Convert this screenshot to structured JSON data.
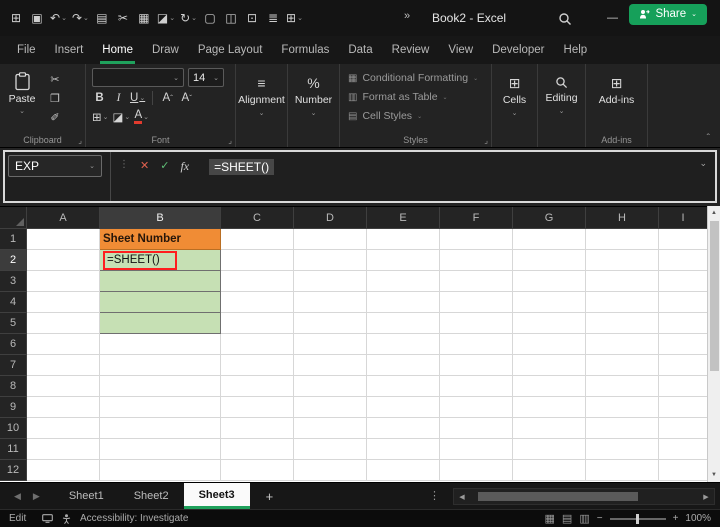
{
  "theme": {
    "accent_green": "#1FA15C",
    "share_green": "#16A05A"
  },
  "icons": {
    "chevron_down": "⌄",
    "dialog_launcher": "⌟",
    "collapse_ribbon": "ˆ",
    "scroll_up": "▲",
    "scroll_down": "▼",
    "arrow_left": "◀",
    "arrow_right": "▶",
    "dots_vertical": "⋮",
    "plus": "+"
  },
  "titlebar": {
    "title": "Book2 - Excel",
    "overflow_glyph": "»",
    "window": {
      "minimize": "—",
      "maximize": "□",
      "close": "✕"
    },
    "qat": [
      {
        "name": "apps-grid-icon",
        "glyph": "⊞"
      },
      {
        "name": "save-icon",
        "glyph": "▣"
      },
      {
        "name": "undo-icon",
        "glyph": "↶",
        "chevron": true
      },
      {
        "name": "redo-icon",
        "glyph": "↷",
        "chevron": true
      },
      {
        "name": "new-sheet-icon",
        "glyph": "▤"
      },
      {
        "name": "cut-icon",
        "glyph": "✂"
      },
      {
        "name": "picture-icon",
        "glyph": "▦"
      },
      {
        "name": "fill-color-icon",
        "glyph": "◪",
        "chevron": true
      },
      {
        "name": "refresh-icon",
        "glyph": "↻",
        "chevron": true
      },
      {
        "name": "document-icon",
        "glyph": "▢"
      },
      {
        "name": "pivot-icon",
        "glyph": "◫"
      },
      {
        "name": "camera-icon",
        "glyph": "⊡"
      },
      {
        "name": "bookshelf-icon",
        "glyph": "≣"
      },
      {
        "name": "table-icon",
        "glyph": "⊞",
        "chevron": true
      }
    ]
  },
  "menu": {
    "tabs": [
      {
        "label": "File"
      },
      {
        "label": "Insert"
      },
      {
        "label": "Home",
        "active": true
      },
      {
        "label": "Draw"
      },
      {
        "label": "Page Layout"
      },
      {
        "label": "Formulas"
      },
      {
        "label": "Data"
      },
      {
        "label": "Review"
      },
      {
        "label": "View"
      },
      {
        "label": "Developer"
      },
      {
        "label": "Help"
      }
    ]
  },
  "share": {
    "label": "Share"
  },
  "ribbon": {
    "clipboard": {
      "paste_label": "Paste",
      "group_label": "Clipboard",
      "icons": [
        {
          "name": "cut-icon",
          "glyph": "✂"
        },
        {
          "name": "copy-icon",
          "glyph": "❐"
        },
        {
          "name": "format-painter-icon",
          "glyph": "✐"
        }
      ]
    },
    "font": {
      "size_value": "14",
      "bold": "B",
      "italic": "I",
      "underline": "U",
      "grow_font": "A",
      "shrink_font": "A",
      "borders_glyph": "⊞",
      "fill_glyph": "◪",
      "font_color_label": "A",
      "group_label": "Font"
    },
    "alignment": {
      "label": "Alignment",
      "icon_glyph": "≡"
    },
    "number": {
      "label": "Number",
      "icon_glyph": "%"
    },
    "styles": {
      "group_label": "Styles",
      "items": [
        {
          "label": "Conditional Formatting",
          "glyph": "▦"
        },
        {
          "label": "Format as Table",
          "glyph": "▥"
        },
        {
          "label": "Cell Styles",
          "glyph": "▤"
        }
      ]
    },
    "cells": {
      "label": "Cells",
      "icon_glyph": "⊞"
    },
    "editing": {
      "label": "Editing"
    },
    "addins": {
      "label": "Add-ins",
      "group_label": "Add-ins",
      "icon_glyph": "⊞"
    }
  },
  "formula_bar": {
    "name_box": "EXP",
    "cancel_glyph": "✕",
    "enter_glyph": "✓",
    "fx_label": "fx",
    "formula": "=SHEET()"
  },
  "grid": {
    "columns": [
      "A",
      "B",
      "C",
      "D",
      "E",
      "F",
      "G",
      "H",
      "I"
    ],
    "row_count": 12,
    "selected_column": "B",
    "selected_row": "2",
    "cells": [
      {
        "ref": "B1",
        "text": "Sheet Number",
        "classes": [
          "orange"
        ]
      },
      {
        "ref": "B2",
        "text": "=SHEET()",
        "classes": [
          "green"
        ],
        "annotated": true
      },
      {
        "ref": "B3",
        "text": "",
        "classes": [
          "green"
        ]
      },
      {
        "ref": "B4",
        "text": "",
        "classes": [
          "green"
        ]
      },
      {
        "ref": "B5",
        "text": "",
        "classes": [
          "green"
        ]
      }
    ],
    "colors": {
      "orange_fill": "#F08C35",
      "green_fill": "#C6E0B4",
      "annotation_red": "#FF1E1E"
    }
  },
  "sheet_tabs": {
    "tabs": [
      {
        "label": "Sheet1"
      },
      {
        "label": "Sheet2"
      },
      {
        "label": "Sheet3",
        "active": true
      }
    ]
  },
  "status_bar": {
    "mode": "Edit",
    "accessibility_label": "Accessibility: Investigate",
    "zoom_out_glyph": "−",
    "zoom_in_glyph": "+",
    "zoom_level": "100%",
    "views": [
      {
        "name": "normal-view-icon",
        "glyph": "▦"
      },
      {
        "name": "page-layout-view-icon",
        "glyph": "▤"
      },
      {
        "name": "page-break-view-icon",
        "glyph": "▥"
      }
    ]
  }
}
